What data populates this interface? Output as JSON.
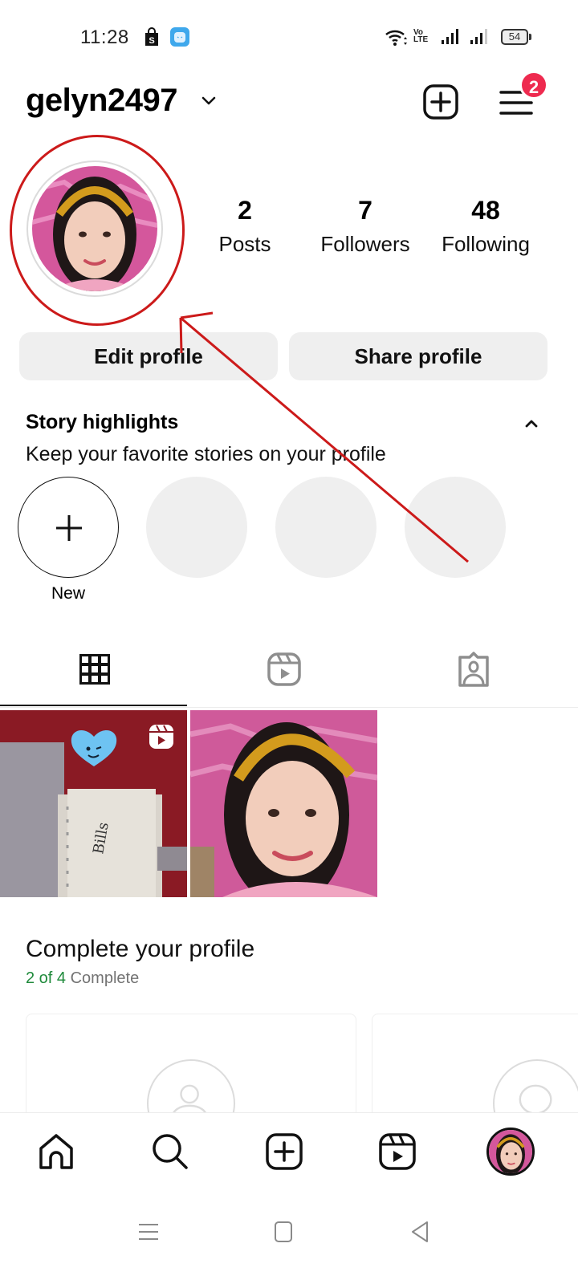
{
  "status_bar": {
    "time": "11:28",
    "notification_icons": [
      "shopping-bag-icon",
      "app-icon"
    ],
    "volte": "Vo\nLTE",
    "battery": "54"
  },
  "header": {
    "username": "gelyn2497",
    "notification_badge": "2"
  },
  "profile": {
    "stats": [
      {
        "value": "2",
        "label": "Posts"
      },
      {
        "value": "7",
        "label": "Followers"
      },
      {
        "value": "48",
        "label": "Following"
      }
    ],
    "edit_label": "Edit profile",
    "share_label": "Share profile"
  },
  "highlights": {
    "title": "Story highlights",
    "subtitle": "Keep your favorite stories on your profile",
    "new_label": "New",
    "placeholder_count": 3
  },
  "tabs": [
    {
      "name": "posts-grid",
      "icon": "grid-icon",
      "active": true
    },
    {
      "name": "reels",
      "icon": "reels-icon",
      "active": false
    },
    {
      "name": "tagged",
      "icon": "tagged-icon",
      "active": false
    }
  ],
  "posts": [
    {
      "type": "reel",
      "description": "binder with heart sticker"
    },
    {
      "type": "photo",
      "description": "selfie with yellow headband"
    }
  ],
  "complete_profile": {
    "title": "Complete your profile",
    "done": "2 of 4",
    "rest": " Complete"
  },
  "bottom_nav": [
    "home-icon",
    "search-icon",
    "create-icon",
    "reels-icon",
    "profile-avatar"
  ],
  "colors": {
    "badge": "#ee2a4f",
    "annotation": "#cc1a1a",
    "complete_green": "#1f8a3b",
    "button_bg": "#efefef"
  }
}
